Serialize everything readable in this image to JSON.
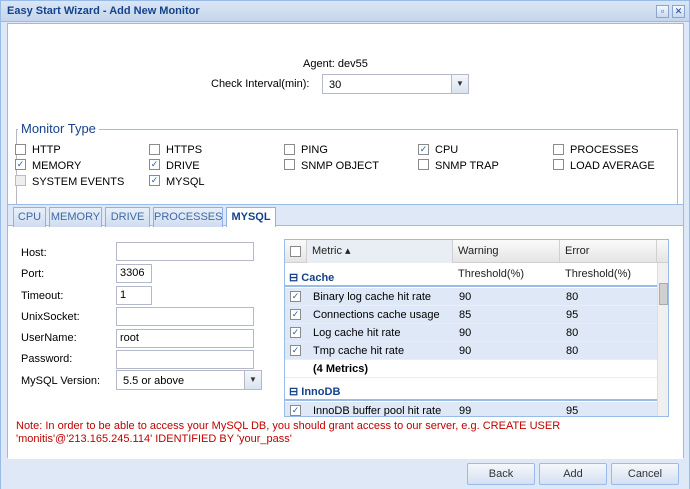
{
  "window": {
    "title": "Easy Start Wizard - Add New Monitor",
    "btn_restore": "▫",
    "btn_close": "✕"
  },
  "agent": {
    "label": "Agent:",
    "value": "dev55"
  },
  "check_interval": {
    "label": "Check Interval(min):",
    "value": "30"
  },
  "monitor_type": {
    "legend": "Monitor Type",
    "options": [
      {
        "label": "HTTP",
        "checked": false
      },
      {
        "label": "HTTPS",
        "checked": false
      },
      {
        "label": "PING",
        "checked": false
      },
      {
        "label": "CPU",
        "checked": true
      },
      {
        "label": "PROCESSES",
        "checked": false
      },
      {
        "label": "MEMORY",
        "checked": true
      },
      {
        "label": "DRIVE",
        "checked": true
      },
      {
        "label": "SNMP OBJECT",
        "checked": false
      },
      {
        "label": "SNMP TRAP",
        "checked": false
      },
      {
        "label": "LOAD AVERAGE",
        "checked": false
      },
      {
        "label": "SYSTEM EVENTS",
        "checked": false
      },
      {
        "label": "MYSQL",
        "checked": true
      }
    ]
  },
  "tabs": [
    "CPU",
    "MEMORY",
    "DRIVE",
    "PROCESSES",
    "MYSQL"
  ],
  "active_tab": "MYSQL",
  "mysql_form": {
    "host_label": "Host:",
    "host_value": "",
    "port_label": "Port:",
    "port_value": "3306",
    "timeout_label": "Timeout:",
    "timeout_value": "1",
    "unixsocket_label": "UnixSocket:",
    "unixsocket_value": "",
    "username_label": "UserName:",
    "username_value": "root",
    "password_label": "Password:",
    "password_value": "",
    "version_label": "MySQL Version:",
    "version_value": "5.5 or above"
  },
  "grid": {
    "columns": [
      "Metric ▴",
      "Warning Threshold(%)",
      "Error Threshold(%)"
    ],
    "groups": [
      {
        "name": "Cache",
        "rows": [
          {
            "metric": "Binary log cache hit rate",
            "warning": "90",
            "error": "80"
          },
          {
            "metric": "Connections cache usage",
            "warning": "85",
            "error": "95"
          },
          {
            "metric": "Log cache hit rate",
            "warning": "90",
            "error": "80"
          },
          {
            "metric": "Tmp cache hit rate",
            "warning": "90",
            "error": "80"
          }
        ],
        "summary": "(4 Metrics)"
      },
      {
        "name": "InnoDB",
        "rows": [
          {
            "metric": "InnoDB buffer pool hit rate",
            "warning": "99",
            "error": "95"
          }
        ]
      }
    ]
  },
  "note": "Note: In order to be able to access your MySQL DB, you should grant access to our server, e.g. CREATE USER 'monitis'@'213.165.245.114' IDENTIFIED BY 'your_pass'",
  "buttons": {
    "back": "Back",
    "add": "Add",
    "cancel": "Cancel"
  }
}
